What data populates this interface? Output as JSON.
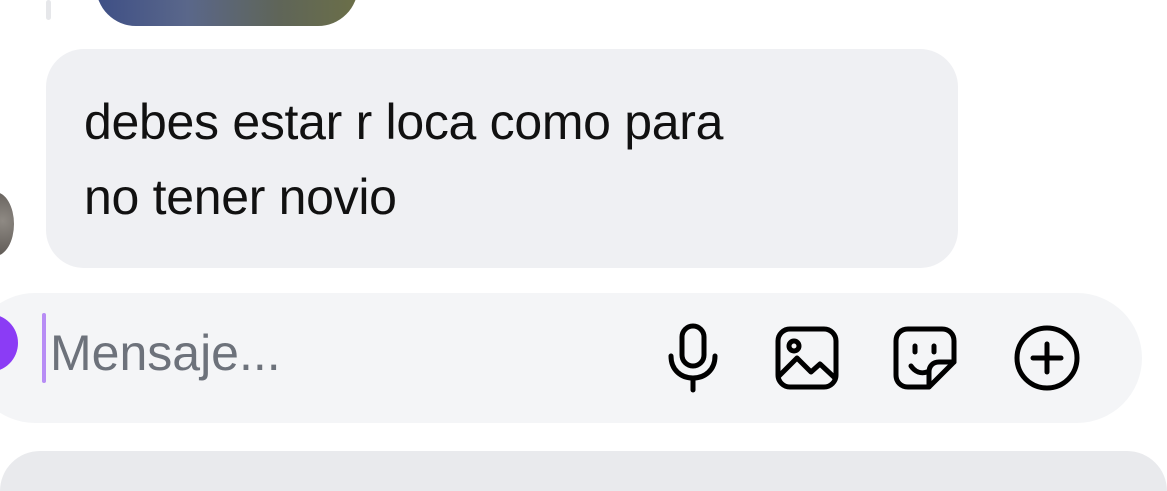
{
  "thread": {
    "received_message": {
      "text": "debes estar r loca como para\nno tener novio"
    }
  },
  "composer": {
    "placeholder": "Mensaje...",
    "actions": [
      {
        "icon": "microphone-icon"
      },
      {
        "icon": "gallery-icon"
      },
      {
        "icon": "sticker-icon"
      },
      {
        "icon": "add-circle-icon"
      }
    ]
  },
  "colors": {
    "bubble_bg": "#eff0f3",
    "composer_bg": "#f4f5f7",
    "accent": "#8b3cf5",
    "caret": "#b78cf5",
    "placeholder": "#6d727b"
  }
}
